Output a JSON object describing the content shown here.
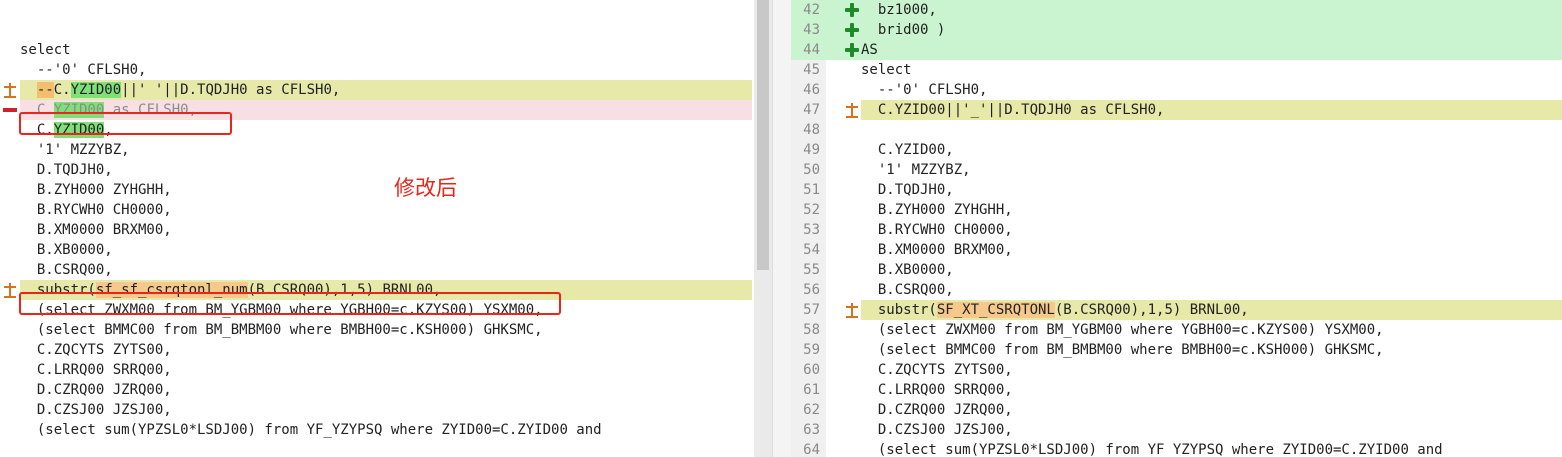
{
  "left": {
    "annotation": "修改后",
    "lines": [
      {
        "type": "gray",
        "segments": [
          {
            "t": ""
          }
        ]
      },
      {
        "type": "gray",
        "segments": [
          {
            "t": ""
          }
        ]
      },
      {
        "type": "normal",
        "segments": [
          {
            "t": "select"
          }
        ]
      },
      {
        "type": "normal",
        "segments": [
          {
            "t": "  --'0' CFLSH0,"
          }
        ]
      },
      {
        "type": "change",
        "marker": "change-icon",
        "segments": [
          {
            "t": "  "
          },
          {
            "t": "--",
            "hl": "orange"
          },
          {
            "t": "C."
          },
          {
            "t": "YZID00",
            "hl": "green"
          },
          {
            "t": "||' '||D.TQDJH0 as CFLSH0,"
          }
        ]
      },
      {
        "type": "removed",
        "marker": "minus-icon",
        "segments": [
          {
            "t": "  C."
          },
          {
            "t": "YZID00",
            "hl": "green"
          },
          {
            "t": " as CFLSH0,"
          }
        ]
      },
      {
        "type": "normal",
        "segments": [
          {
            "t": "  C."
          },
          {
            "t": "YZID00",
            "hl": "green"
          },
          {
            "t": ","
          }
        ]
      },
      {
        "type": "normal",
        "segments": [
          {
            "t": "  '1' MZZYBZ,"
          }
        ]
      },
      {
        "type": "normal",
        "segments": [
          {
            "t": "  D.TQDJH0,"
          }
        ]
      },
      {
        "type": "normal",
        "segments": [
          {
            "t": "  B.ZYH000 ZYHGHH,"
          }
        ]
      },
      {
        "type": "normal",
        "segments": [
          {
            "t": "  B.RYCWH0 CH0000,"
          }
        ]
      },
      {
        "type": "normal",
        "segments": [
          {
            "t": "  B.XM0000 BRXM00,"
          }
        ]
      },
      {
        "type": "normal",
        "segments": [
          {
            "t": "  B.XB0000,"
          }
        ]
      },
      {
        "type": "normal",
        "segments": [
          {
            "t": "  B.CSRQ00,"
          }
        ]
      },
      {
        "type": "change",
        "marker": "change-icon",
        "segments": [
          {
            "t": "  substr("
          },
          {
            "t": "sf_sf_csrqtonl_num",
            "hl": "peach"
          },
          {
            "t": "(B.CSRQ00),1,5) BRNL00,"
          }
        ]
      },
      {
        "type": "normal",
        "segments": [
          {
            "t": "  (select ZWXM00 from BM_YGBM00 where YGBH00=c.KZYS00) YSXM00,"
          }
        ]
      },
      {
        "type": "normal",
        "segments": [
          {
            "t": "  (select BMMC00 from BM_BMBM00 where BMBH00=c.KSH000) GHKSMC,"
          }
        ]
      },
      {
        "type": "normal",
        "segments": [
          {
            "t": "  C.ZQCYTS ZYTS00,"
          }
        ]
      },
      {
        "type": "normal",
        "segments": [
          {
            "t": "  C.LRRQ00 SRRQ00,"
          }
        ]
      },
      {
        "type": "normal",
        "segments": [
          {
            "t": "  D.CZRQ00 JZRQ00,"
          }
        ]
      },
      {
        "type": "normal",
        "segments": [
          {
            "t": "  D.CZSJ00 JZSJ00,"
          }
        ]
      },
      {
        "type": "normal",
        "segments": [
          {
            "t": "  (select sum(YPZSL0*LSDJ00) from YF_YZYPSQ where ZYID00=C.ZYID00 and"
          }
        ]
      }
    ]
  },
  "right": {
    "lines": [
      {
        "no": "42",
        "type": "added",
        "marker": "plus-icon",
        "segments": [
          {
            "t": "  bz1000,"
          }
        ]
      },
      {
        "no": "43",
        "type": "added",
        "marker": "plus-icon",
        "segments": [
          {
            "t": "  brid00 )"
          }
        ]
      },
      {
        "no": "44",
        "type": "added",
        "marker": "plus-icon",
        "segments": [
          {
            "t": "AS"
          }
        ]
      },
      {
        "no": "45",
        "type": "normal",
        "segments": [
          {
            "t": "select"
          }
        ]
      },
      {
        "no": "46",
        "type": "normal",
        "segments": [
          {
            "t": "  --'0' CFLSH0,"
          }
        ]
      },
      {
        "no": "47",
        "type": "change",
        "marker": "change-icon",
        "segments": [
          {
            "t": "  C.YZID00||'_'||D.TQDJH0 as CFLSH0,"
          }
        ]
      },
      {
        "no": "48",
        "type": "gap",
        "segments": [
          {
            "t": ""
          }
        ]
      },
      {
        "no": "49",
        "type": "normal",
        "segments": [
          {
            "t": "  C.YZID00,"
          }
        ]
      },
      {
        "no": "50",
        "type": "normal",
        "segments": [
          {
            "t": "  '1' MZZYBZ,"
          }
        ]
      },
      {
        "no": "51",
        "type": "normal",
        "segments": [
          {
            "t": "  D.TQDJH0,"
          }
        ]
      },
      {
        "no": "52",
        "type": "normal",
        "segments": [
          {
            "t": "  B.ZYH000 ZYHGHH,"
          }
        ]
      },
      {
        "no": "53",
        "type": "normal",
        "segments": [
          {
            "t": "  B.RYCWH0 CH0000,"
          }
        ]
      },
      {
        "no": "54",
        "type": "normal",
        "segments": [
          {
            "t": "  B.XM0000 BRXM00,"
          }
        ]
      },
      {
        "no": "55",
        "type": "normal",
        "segments": [
          {
            "t": "  B.XB0000,"
          }
        ]
      },
      {
        "no": "56",
        "type": "normal",
        "segments": [
          {
            "t": "  B.CSRQ00,"
          }
        ]
      },
      {
        "no": "57",
        "type": "change",
        "marker": "change-icon",
        "segments": [
          {
            "t": "  substr("
          },
          {
            "t": "SF_XT_CSRQTONL",
            "hl": "peach"
          },
          {
            "t": "(B.CSRQ00),1,5) BRNL00,"
          }
        ]
      },
      {
        "no": "58",
        "type": "normal",
        "segments": [
          {
            "t": "  (select ZWXM00 from BM_YGBM00 where YGBH00=c.KZYS00) YSXM00,"
          }
        ]
      },
      {
        "no": "59",
        "type": "normal",
        "segments": [
          {
            "t": "  (select BMMC00 from BM_BMBM00 where BMBH00=c.KSH000) GHKSMC,"
          }
        ]
      },
      {
        "no": "60",
        "type": "normal",
        "segments": [
          {
            "t": "  C.ZQCYTS ZYTS00,"
          }
        ]
      },
      {
        "no": "61",
        "type": "normal",
        "segments": [
          {
            "t": "  C.LRRQ00 SRRQ00,"
          }
        ]
      },
      {
        "no": "62",
        "type": "normal",
        "segments": [
          {
            "t": "  D.CZRQ00 JZRQ00,"
          }
        ]
      },
      {
        "no": "63",
        "type": "normal",
        "segments": [
          {
            "t": "  D.CZSJ00 JZSJ00,"
          }
        ]
      },
      {
        "no": "64",
        "type": "normal",
        "segments": [
          {
            "t": "  (select sum(YPZSL0*LSDJ00) from YF_YZYPSQ where ZYID00=C.ZYID00 and"
          }
        ]
      }
    ]
  }
}
